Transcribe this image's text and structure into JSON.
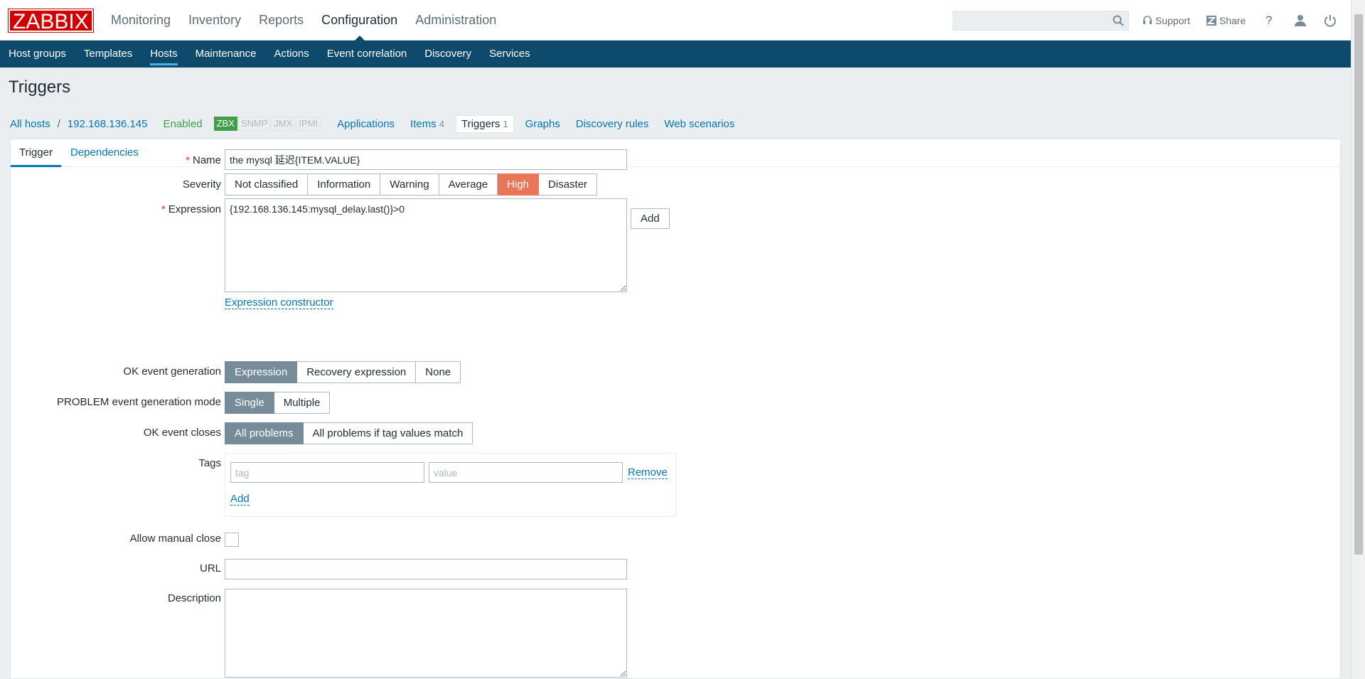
{
  "brand": {
    "logo": "ZABBIX"
  },
  "main_nav": [
    "Monitoring",
    "Inventory",
    "Reports",
    "Configuration",
    "Administration"
  ],
  "main_nav_active": "Configuration",
  "top_right": {
    "support": "Support",
    "share": "Share",
    "help": "?"
  },
  "sub_nav": [
    "Host groups",
    "Templates",
    "Hosts",
    "Maintenance",
    "Actions",
    "Event correlation",
    "Discovery",
    "Services"
  ],
  "sub_nav_active": "Hosts",
  "page": {
    "title": "Triggers"
  },
  "host_nav": {
    "all_hosts": "All hosts",
    "separator": "/",
    "host": "192.168.136.145",
    "status": "Enabled",
    "badges": [
      "ZBX",
      "SNMP",
      "JMX",
      "IPMI"
    ],
    "applications": "Applications",
    "items": "Items",
    "items_count": "4",
    "triggers": "Triggers",
    "triggers_count": "1",
    "graphs": "Graphs",
    "discovery_rules": "Discovery rules",
    "web_scenarios": "Web scenarios"
  },
  "tabs": [
    "Trigger",
    "Dependencies"
  ],
  "form": {
    "name_label": "Name",
    "name_value": "the mysql 延迟{ITEM.VALUE}",
    "severity_label": "Severity",
    "severity_options": [
      "Not classified",
      "Information",
      "Warning",
      "Average",
      "High",
      "Disaster"
    ],
    "severity_selected": "High",
    "expression_label": "Expression",
    "expression_value": "{192.168.136.145:mysql_delay.last()}>0",
    "add_label": "Add",
    "expression_constructor": "Expression constructor",
    "ok_event_label": "OK event generation",
    "ok_event_options": [
      "Expression",
      "Recovery expression",
      "None"
    ],
    "ok_event_selected": "Expression",
    "problem_mode_label": "PROBLEM event generation mode",
    "problem_mode_options": [
      "Single",
      "Multiple"
    ],
    "problem_mode_selected": "Single",
    "ok_closes_label": "OK event closes",
    "ok_closes_options": [
      "All problems",
      "All problems if tag values match"
    ],
    "ok_closes_selected": "All problems",
    "tags_label": "Tags",
    "tag_placeholder": "tag",
    "value_placeholder": "value",
    "remove_label": "Remove",
    "tag_add_label": "Add",
    "manual_close_label": "Allow manual close",
    "url_label": "URL",
    "url_value": "",
    "description_label": "Description",
    "description_value": ""
  },
  "colors": {
    "header_blue": "#0e4a6b",
    "high_severity": "#e97659",
    "selected_segment": "#768d99",
    "link": "#0275b8",
    "enabled_green": "#429e47",
    "logo_red": "#d40000"
  }
}
